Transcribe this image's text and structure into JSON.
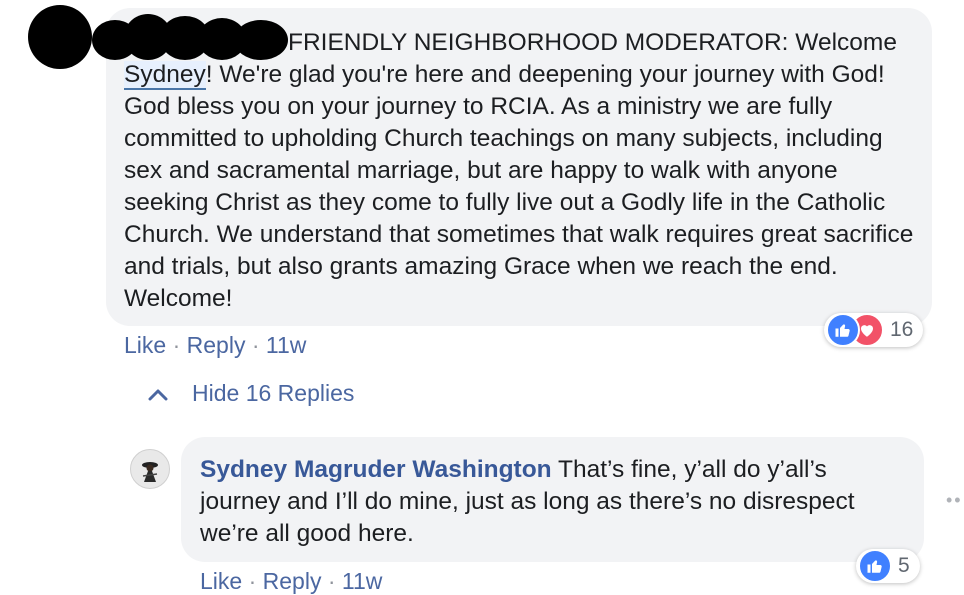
{
  "main_comment": {
    "author_display": "FRIENDLY NEIGHBORHOOD MODERATOR:",
    "body_before_mention": " Welcome",
    "mention": "Sydney",
    "body_after_mention": "! We're glad you're here and deepening your journey with God! God bless you on your journey to RCIA. As a ministry we are fully committed to upholding Church teachings on many subjects, including sex and sacramental marriage, but are happy to walk with anyone seeking Christ as they come to fully live out a Godly life in the Catholic Church. We understand that sometimes that walk requires great sacrifice and trials, but also grants amazing Grace when we reach the end. Welcome!",
    "actions": {
      "like": "Like",
      "sep": "·",
      "reply": "Reply",
      "time": "11w"
    },
    "reactions": {
      "icons": [
        "like-icon",
        "love-icon"
      ],
      "count": "16"
    }
  },
  "replies_toggle": {
    "label": "Hide 16 Replies",
    "icon": "chevron-up-icon"
  },
  "reply": {
    "author": "Sydney Magruder Washington",
    "body": "That’s fine, y’all do y’all’s journey and I’ll do mine, just as long as there’s no disrespect we’re all good here.",
    "actions": {
      "like": "Like",
      "sep": "·",
      "reply": "Reply",
      "time": "11w"
    },
    "reactions": {
      "icons": [
        "like-icon"
      ],
      "count": "5"
    }
  },
  "colors": {
    "link": "#4b67a1",
    "author": "#385898",
    "bubble": "#f2f3f5",
    "like": "#4080ff",
    "love": "#f25268"
  }
}
